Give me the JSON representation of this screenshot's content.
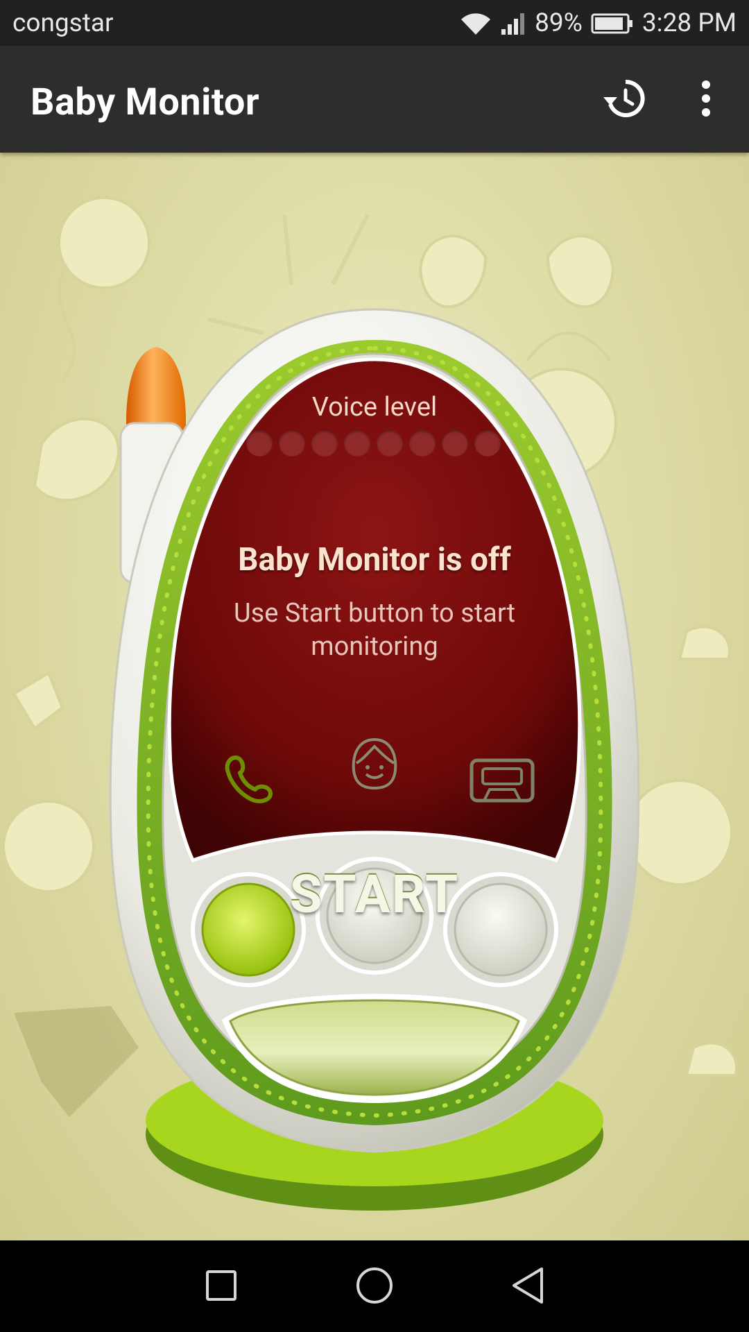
{
  "status_bar": {
    "carrier": "congstar",
    "battery": "89%",
    "time": "3:28 PM"
  },
  "app_bar": {
    "title": "Baby Monitor"
  },
  "monitor": {
    "voice_level_label": "Voice level",
    "voice_level_dots": 8,
    "state_title": "Baby Monitor is off",
    "state_subtitle_line1": "Use Start button to start",
    "state_subtitle_line2": "monitoring",
    "start_button_label": "START"
  },
  "colors": {
    "app_bar": "#2d2d2d",
    "background": "#dcdaa3",
    "screen": "#7a0c0c",
    "device_green": "#7fb52a",
    "call_button": "#b8dc12"
  },
  "icons": [
    "wifi-icon",
    "signal-icon",
    "battery-icon",
    "history-icon",
    "overflow-menu-icon",
    "phone-icon",
    "face-icon",
    "cassette-icon",
    "recent-apps-icon",
    "home-icon",
    "back-icon"
  ]
}
